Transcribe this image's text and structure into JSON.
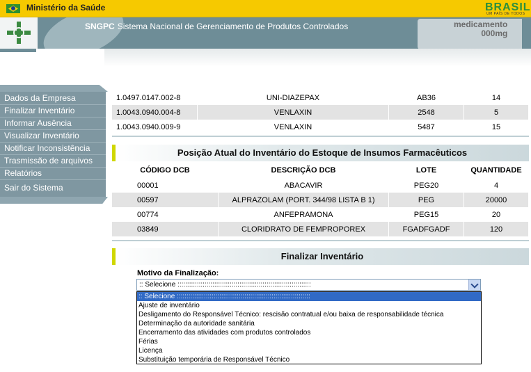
{
  "gov": {
    "title": "Ministério da Saúde",
    "brand_word": "BRASIL",
    "brand_tag": "UM PAÍS DE TODOS"
  },
  "header": {
    "system_abbr": "SNGPC",
    "system_name": "Sistema Nacional de Gerenciamento de Produtos Controlados",
    "pill_text_1": "medicamento",
    "pill_text_2": "000mg"
  },
  "sidebar": {
    "items": [
      {
        "label": "Dados da Empresa"
      },
      {
        "label": "Finalizar Inventário"
      },
      {
        "label": "Informar Ausência"
      },
      {
        "label": "Visualizar Inventário"
      },
      {
        "label": "Notificar Inconsistência"
      },
      {
        "label": "Trasmissão de arquivos"
      },
      {
        "label": "Relatórios"
      },
      {
        "label": "Sair do Sistema"
      }
    ]
  },
  "medicamentos_rows": [
    {
      "codigo": "1.0497.0147.002-8",
      "descricao": "UNI-DIAZEPAX",
      "lote": "AB36",
      "quantidade": "14"
    },
    {
      "codigo": "1.0043.0940.004-8",
      "descricao": "VENLAXIN",
      "lote": "2548",
      "quantidade": "5"
    },
    {
      "codigo": "1.0043.0940.009-9",
      "descricao": "VENLAXIN",
      "lote": "5487",
      "quantidade": "15"
    }
  ],
  "insumos": {
    "title": "Posição Atual do Inventário do Estoque de Insumos Farmacêuticos",
    "headers": {
      "codigo": "CÓDIGO DCB",
      "descricao": "DESCRIÇÃO DCB",
      "lote": "LOTE",
      "quantidade": "QUANTIDADE"
    },
    "rows": [
      {
        "codigo": "00001",
        "descricao": "ABACAVIR",
        "lote": "PEG20",
        "quantidade": "4"
      },
      {
        "codigo": "00597",
        "descricao": "ALPRAZOLAM (PORT. 344/98 LISTA B 1)",
        "lote": "PEG",
        "quantidade": "20000"
      },
      {
        "codigo": "00774",
        "descricao": "ANFEPRAMONA",
        "lote": "PEG15",
        "quantidade": "20"
      },
      {
        "codigo": "03849",
        "descricao": "CLORIDRATO DE FEMPROPOREX",
        "lote": "FGADFGADF",
        "quantidade": "120"
      }
    ]
  },
  "finalizar": {
    "title": "Finalizar Inventário",
    "motivo_label": "Motivo da Finalização:",
    "select_value": ":: Selecione :::::::::::::::::::::::::::::::::::::::::::::::::::::::::::::::::::::",
    "options": [
      ":: Selecione :::::::::::::::::::::::::::::::::::::::::::::::::::::::::::::::::::::",
      "Ajuste de inventário",
      "Desligamento do Responsável Técnico: rescisão contratual e/ou baixa de responsabilidade técnica",
      "Determinação da autoridade sanitária",
      "Encerramento das atividades com produtos controlados",
      "Férias",
      "Licença",
      "Substituição temporária de Responsável Técnico"
    ]
  }
}
